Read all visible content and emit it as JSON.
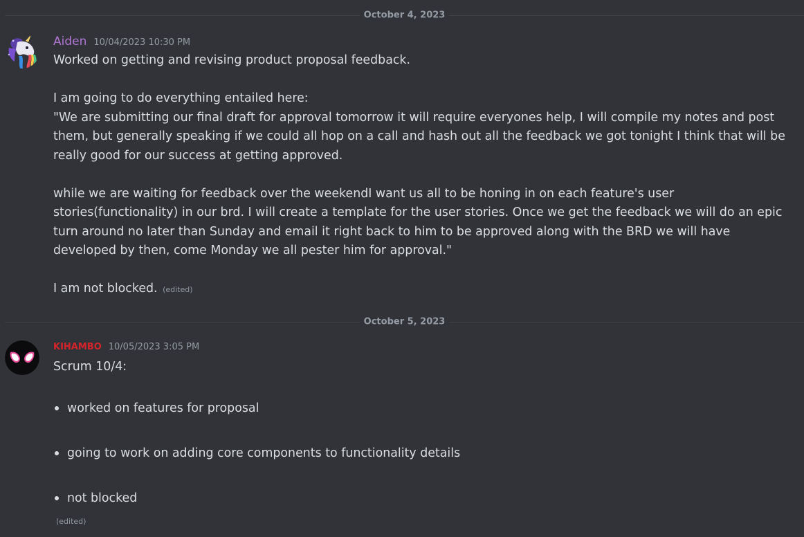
{
  "dividers": [
    "October 4, 2023",
    "October 5, 2023"
  ],
  "messages": [
    {
      "username": "Aiden",
      "username_color": "#b176d6",
      "timestamp": "10/04/2023 10:30 PM",
      "paragraphs": [
        "Worked on getting and revising product proposal feedback.",
        "I am going to do everything entailed here:",
        "\"We are submitting our final draft for approval tomorrow it will require everyones help, I will compile my notes and post them, but generally speaking if we could all hop on a call and hash out all the feedback we got tonight I think that will be really good for our success at getting approved.",
        "while we are waiting for feedback over the weekendI want us all to be honing in on each feature's user stories(functionality) in our brd. I will create a template for the user stories. Once we get the feedback we will do an epic turn around no later than Sunday and email it right back to him to be approved along with the BRD we will have developed by then, come Monday we all pester him for approval.\"",
        "I am not blocked."
      ],
      "edited_label": "(edited)"
    },
    {
      "username": "KIHAMBO",
      "username_color": "#d4242b",
      "timestamp": "10/05/2023 3:05 PM",
      "intro": "Scrum 10/4:",
      "items": [
        "worked on features for proposal",
        "going to work on adding core components to functionality details",
        "not blocked"
      ],
      "edited_label": "(edited)"
    }
  ],
  "icons": {
    "aiden_avatar": "unicorn-avatar-icon",
    "kihambo_avatar": "spider-mask-avatar-icon"
  }
}
